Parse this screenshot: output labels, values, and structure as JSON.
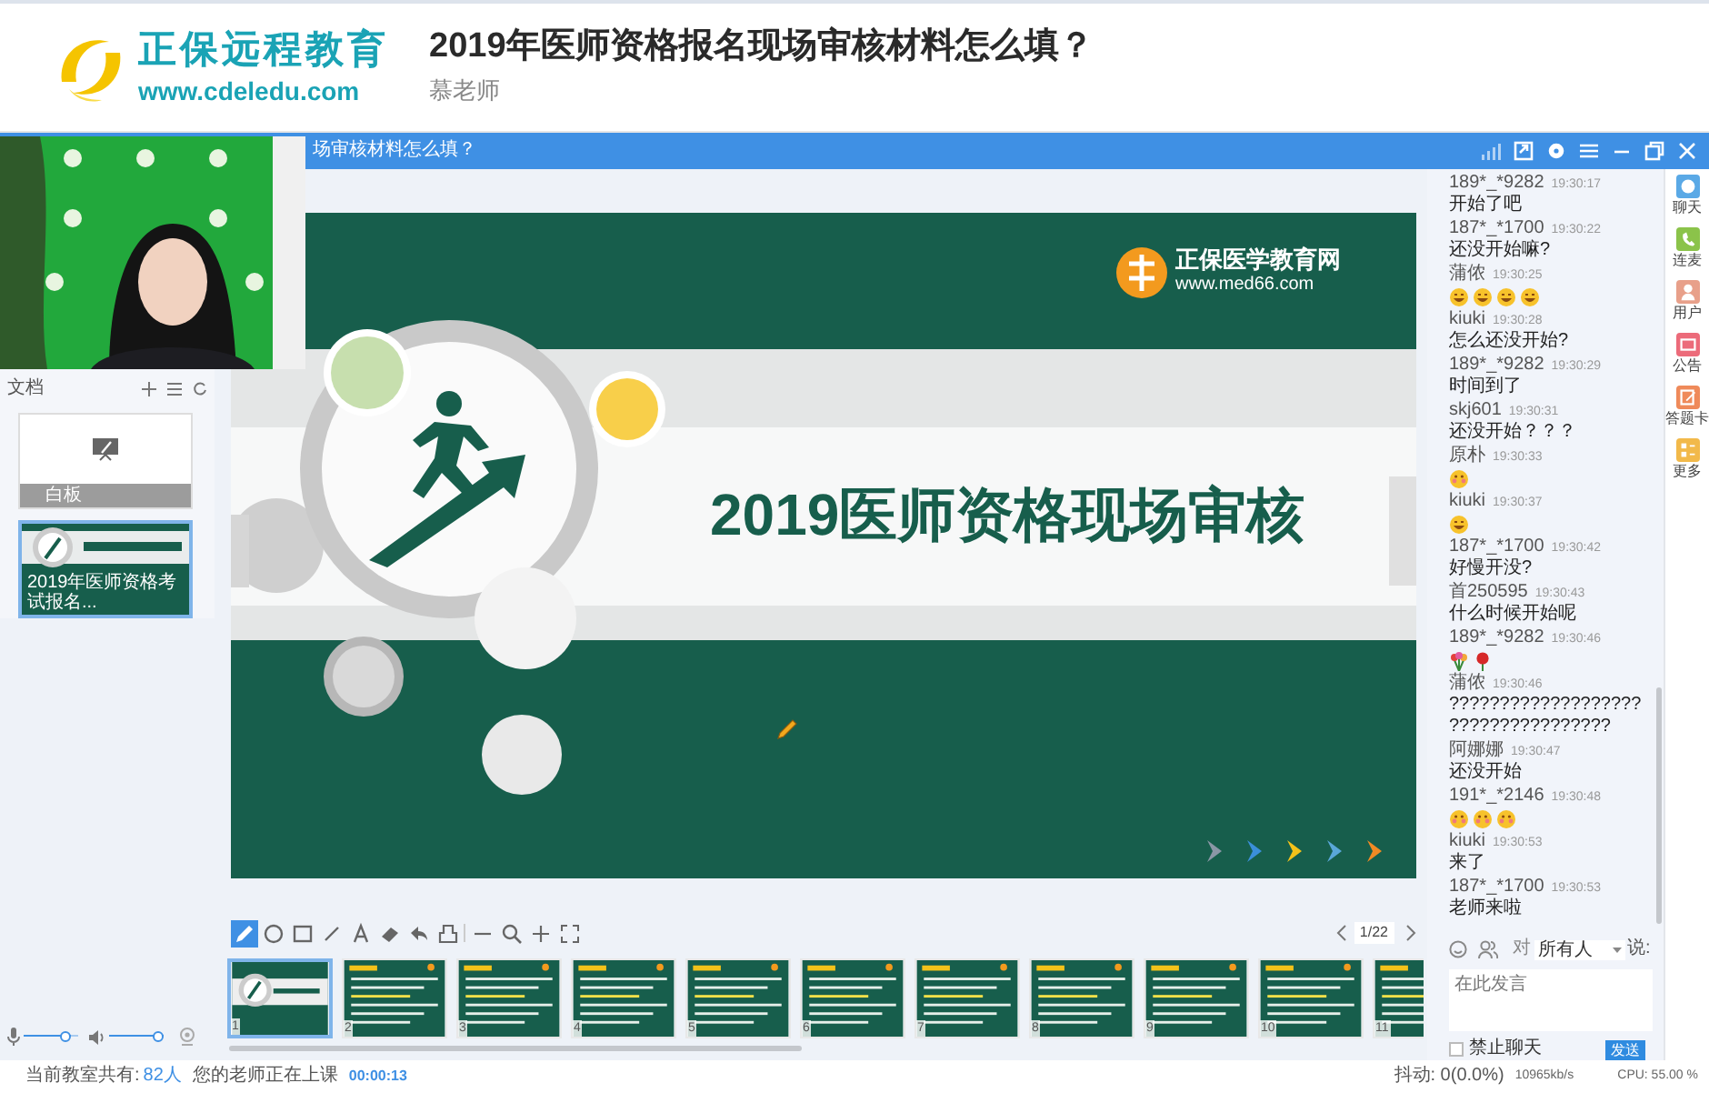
{
  "header": {
    "brand": "正保远程教育",
    "brand_url": "www.cdeledu.com",
    "title": "2019年医师资格报名现场审核材料怎么填？",
    "teacher": "慕老师"
  },
  "topbar": {
    "title": "场审核材料怎么填？"
  },
  "documents": {
    "title": "文档",
    "items": [
      {
        "kind": "whiteboard",
        "label": "白板",
        "selected": false
      },
      {
        "kind": "slides",
        "label": "2019年医师资格考试报名...",
        "selected": true
      }
    ]
  },
  "slide": {
    "logo_name": "正保医学教育网",
    "logo_url": "www.med66.com",
    "title": "2019医师资格现场审核"
  },
  "tools": [
    {
      "kind": "pen",
      "selected": true
    },
    {
      "kind": "circle",
      "selected": false
    },
    {
      "kind": "rect",
      "selected": false
    },
    {
      "kind": "line",
      "selected": false
    },
    {
      "kind": "text",
      "selected": false
    },
    {
      "kind": "eraser",
      "selected": false
    },
    {
      "kind": "undo",
      "selected": false
    },
    {
      "kind": "clear",
      "selected": false
    },
    {
      "kind": "zoom-out",
      "selected": false
    },
    {
      "kind": "zoom",
      "selected": false
    },
    {
      "kind": "zoom-in",
      "selected": false
    },
    {
      "kind": "fullscreen",
      "selected": false
    }
  ],
  "page": "1/22",
  "thumbnails": [
    {
      "number": "1",
      "kind": "title",
      "selected": true
    },
    {
      "number": "2",
      "kind": "text",
      "selected": false
    },
    {
      "number": "3",
      "kind": "text",
      "selected": false
    },
    {
      "number": "4",
      "kind": "text",
      "selected": false
    },
    {
      "number": "5",
      "kind": "text",
      "selected": false
    },
    {
      "number": "6",
      "kind": "text",
      "selected": false
    },
    {
      "number": "7",
      "kind": "text",
      "selected": false
    },
    {
      "number": "8",
      "kind": "text",
      "selected": false
    },
    {
      "number": "9",
      "kind": "text",
      "selected": false
    },
    {
      "number": "10",
      "kind": "text",
      "selected": false
    },
    {
      "number": "11",
      "kind": "text",
      "selected": false
    }
  ],
  "audio": {
    "microphone": {
      "level": 0.85
    },
    "speaker": {
      "level": 1
    }
  },
  "status": {
    "label": "当前教室共有:",
    "count": "82人",
    "message": "您的老师正在上课",
    "timer": "00:00:13"
  },
  "chat": {
    "messages": [
      {
        "user": "189*_*9282",
        "time": "19:30:17",
        "kind": "text",
        "text": "开始了吧"
      },
      {
        "user": "187*_*1700",
        "time": "19:30:22",
        "kind": "text",
        "text": "还没开始嘛?"
      },
      {
        "user": "蒲侬",
        "time": "19:30:25",
        "kind": "emoji",
        "emojis": [
          {
            "kind": "grin"
          },
          {
            "kind": "grin"
          },
          {
            "kind": "grin"
          },
          {
            "kind": "grin"
          }
        ]
      },
      {
        "user": "kiuki",
        "time": "19:30:28",
        "kind": "text",
        "text": "怎么还没开始?"
      },
      {
        "user": "189*_*9282",
        "time": "19:30:29",
        "kind": "text",
        "text": "时间到了"
      },
      {
        "user": "skj601",
        "time": "19:30:31",
        "kind": "text",
        "text": "还没开始？？？"
      },
      {
        "user": "原朴",
        "time": "19:30:33",
        "kind": "emoji",
        "emojis": [
          {
            "kind": "blush"
          }
        ]
      },
      {
        "user": "kiuki",
        "time": "19:30:37",
        "kind": "emoji",
        "emojis": [
          {
            "kind": "grin"
          }
        ]
      },
      {
        "user": "187*_*1700",
        "time": "19:30:42",
        "kind": "text",
        "text": "好慢开没?"
      },
      {
        "user": "首250595",
        "time": "19:30:43",
        "kind": "text",
        "text": "什么时候开始呢"
      },
      {
        "user": "189*_*9282",
        "time": "19:30:46",
        "kind": "emoji",
        "emojis": [
          {
            "kind": "flower"
          },
          {
            "kind": "rose"
          }
        ]
      },
      {
        "user": "蒲侬",
        "time": "19:30:46",
        "kind": "text",
        "text": "???????????????????????????????????"
      },
      {
        "user": "阿娜娜",
        "time": "19:30:47",
        "kind": "text",
        "text": "还没开始"
      },
      {
        "user": "191*_*2146",
        "time": "19:30:48",
        "kind": "emoji",
        "emojis": [
          {
            "kind": "blush"
          },
          {
            "kind": "blush"
          },
          {
            "kind": "blush"
          }
        ]
      },
      {
        "user": "kiuki",
        "time": "19:30:53",
        "kind": "text",
        "text": "来了"
      },
      {
        "user": "187*_*1700",
        "time": "19:30:53",
        "kind": "text",
        "text": "老师来啦"
      }
    ],
    "to_label": "对",
    "recipient": "所有人",
    "say_label": "说:",
    "placeholder": "在此发言",
    "mute_label": "禁止聊天",
    "mute_checked": false,
    "send": "发送"
  },
  "side_tabs": [
    {
      "kind": "chat",
      "label": "聊天",
      "color": "#5aa9e6"
    },
    {
      "kind": "phone",
      "label": "连麦",
      "color": "#8bc34a"
    },
    {
      "kind": "user",
      "label": "用户",
      "color": "#e8a08a"
    },
    {
      "kind": "notice",
      "label": "公告",
      "color": "#ec6b7a"
    },
    {
      "kind": "answer",
      "label": "答题卡",
      "color": "#ef8a5a"
    },
    {
      "kind": "more",
      "label": "更多",
      "color": "#f2b94a"
    }
  ],
  "netstats": {
    "jitter": "抖动: 0(0.0%)",
    "rate": "10965kb/s",
    "cpu": "CPU: 55.00 %"
  }
}
